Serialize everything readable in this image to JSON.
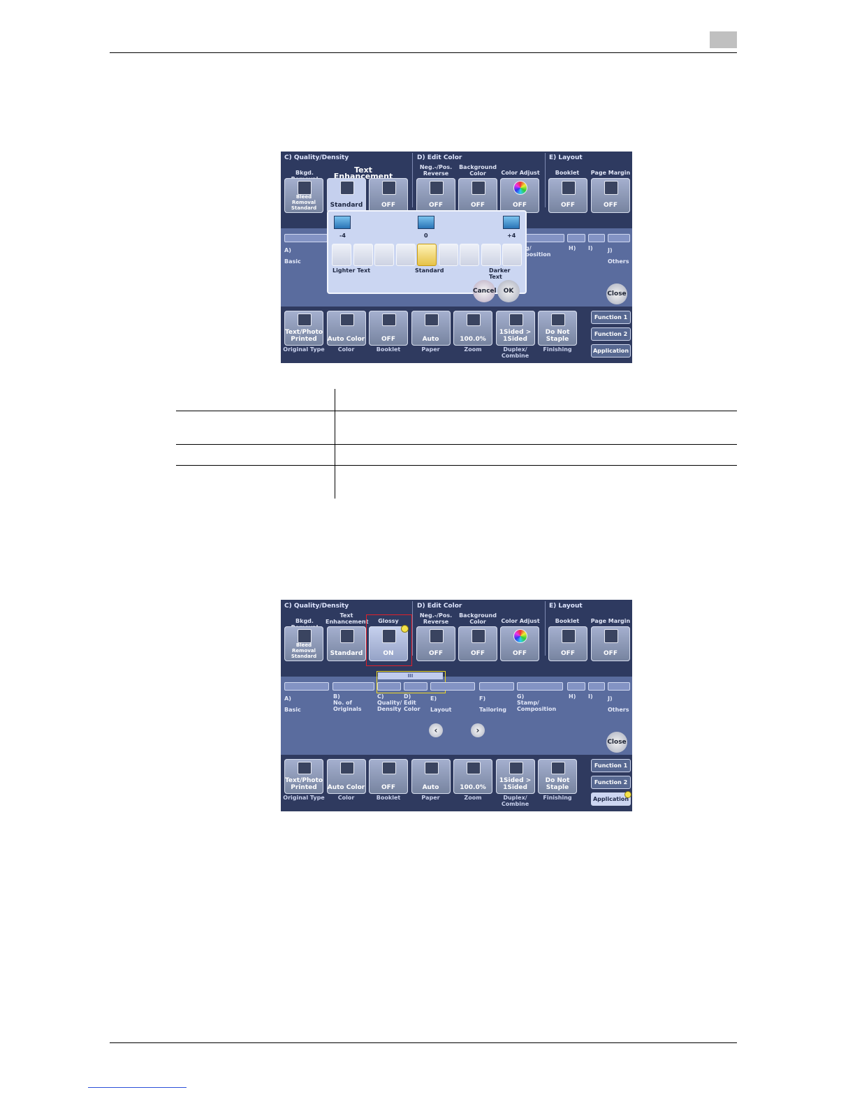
{
  "page": {
    "chapter_box": ""
  },
  "screen1": {
    "sections": {
      "quality": "C)  Quality/Density",
      "edit_color": "D)  Edit Color",
      "layout": "E)  Layout"
    },
    "top_labels": {
      "bkgd_removal": "Bkgd. Removal",
      "text_enh_title": "Text Enhancement",
      "neg_pos": "Neg.-/Pos.\nReverse",
      "background_color": "Background\nColor",
      "color_adjust": "Color Adjust",
      "booklet": "Booklet",
      "page_margin": "Page Margin"
    },
    "top_values": {
      "bkgd": "Bleed\nRemoval\nStandard",
      "text_enh": "Standard",
      "glossy": "OFF",
      "neg_pos": "OFF",
      "background_color": "OFF",
      "color_adjust": "OFF",
      "booklet": "OFF",
      "page_margin": "OFF"
    },
    "dialog": {
      "min": "-4",
      "mid": "0",
      "max": "+4",
      "lighter": "Lighter Text",
      "standard": "Standard",
      "darker": "Darker Text",
      "cancel": "Cancel",
      "ok": "OK",
      "levels": 9,
      "selected_level": 5
    },
    "group_labels": {
      "a": "A)\nBasic",
      "partial_g": "g/\nposition",
      "h": "H)",
      "i": "I)",
      "j": "J)\nOthers"
    },
    "close": "Close"
  },
  "screen2": {
    "sections": {
      "quality": "C)  Quality/Density",
      "edit_color": "D)  Edit Color",
      "layout": "E)  Layout"
    },
    "top_labels": {
      "bkgd_removal": "Bkgd. Removal",
      "text_enh": "Text\nEnhancement",
      "glossy": "Glossy",
      "neg_pos": "Neg.-/Pos.\nReverse",
      "background_color": "Background\nColor",
      "color_adjust": "Color Adjust",
      "booklet": "Booklet",
      "page_margin": "Page Margin"
    },
    "top_values": {
      "bkgd": "Bleed\nRemoval\nStandard",
      "text_enh": "Standard",
      "glossy": "ON",
      "neg_pos": "OFF",
      "background_color": "OFF",
      "color_adjust": "OFF",
      "booklet": "OFF",
      "page_margin": "OFF"
    },
    "group_labels": {
      "a": "A)\nBasic",
      "b": "B)\nNo. of\nOriginals",
      "c": "C)\nQuality/\nDensity",
      "d": "D)\nEdit\nColor",
      "e": "E)\nLayout",
      "f": "F)\nTailoring",
      "g": "G)\nStamp/\nComposition",
      "h": "H)",
      "i": "I)",
      "j": "J)\nOthers"
    },
    "scroll_thumb": "III",
    "close": "Close"
  },
  "bottom_bar": {
    "buttons": [
      {
        "value": "Text/Photo\nPrinted",
        "caption": "Original Type"
      },
      {
        "value": "Auto Color",
        "caption": "Color"
      },
      {
        "value": "OFF",
        "caption": "Booklet"
      },
      {
        "value": "Auto",
        "caption": "Paper"
      },
      {
        "value": "100.0%",
        "caption": "Zoom"
      },
      {
        "value": "1Sided >\n1Sided",
        "caption": "Duplex/\nCombine"
      },
      {
        "value": "Do Not\nStaple",
        "caption": "Finishing"
      }
    ],
    "functions": [
      "Function 1",
      "Function 2",
      "Application"
    ]
  }
}
